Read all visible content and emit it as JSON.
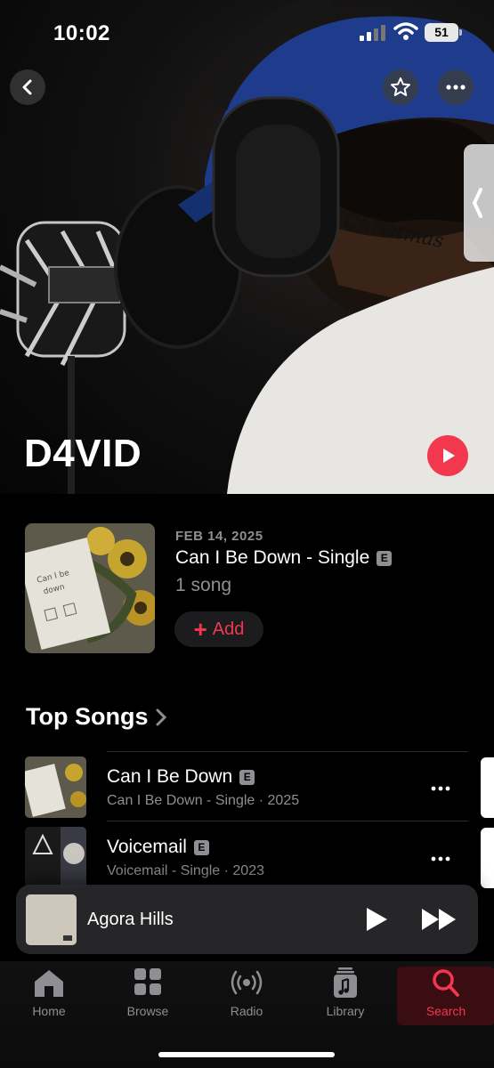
{
  "status": {
    "time": "10:02",
    "battery": "51"
  },
  "artist": {
    "name": "D4VID"
  },
  "latest_release": {
    "date": "FEB 14, 2025",
    "title": "Can I Be Down - Single",
    "explicit": "E",
    "song_count": "1 song",
    "add_label": "Add"
  },
  "top_songs": {
    "heading": "Top Songs",
    "items": [
      {
        "title": "Can I Be Down",
        "explicit": "E",
        "subtitle": "Can I Be Down - Single · 2025"
      },
      {
        "title": "Voicemail",
        "explicit": "E",
        "subtitle": "Voicemail - Single · 2023"
      }
    ]
  },
  "now_playing": {
    "title": "Agora Hills"
  },
  "tabs": [
    {
      "label": "Home",
      "icon": "home-icon"
    },
    {
      "label": "Browse",
      "icon": "browse-grid-icon"
    },
    {
      "label": "Radio",
      "icon": "radio-icon"
    },
    {
      "label": "Library",
      "icon": "library-icon"
    },
    {
      "label": "Search",
      "icon": "search-icon",
      "active": true
    }
  ],
  "colors": {
    "accent": "#f2384e",
    "secondary_text": "#8e8e93",
    "background": "#000000"
  }
}
